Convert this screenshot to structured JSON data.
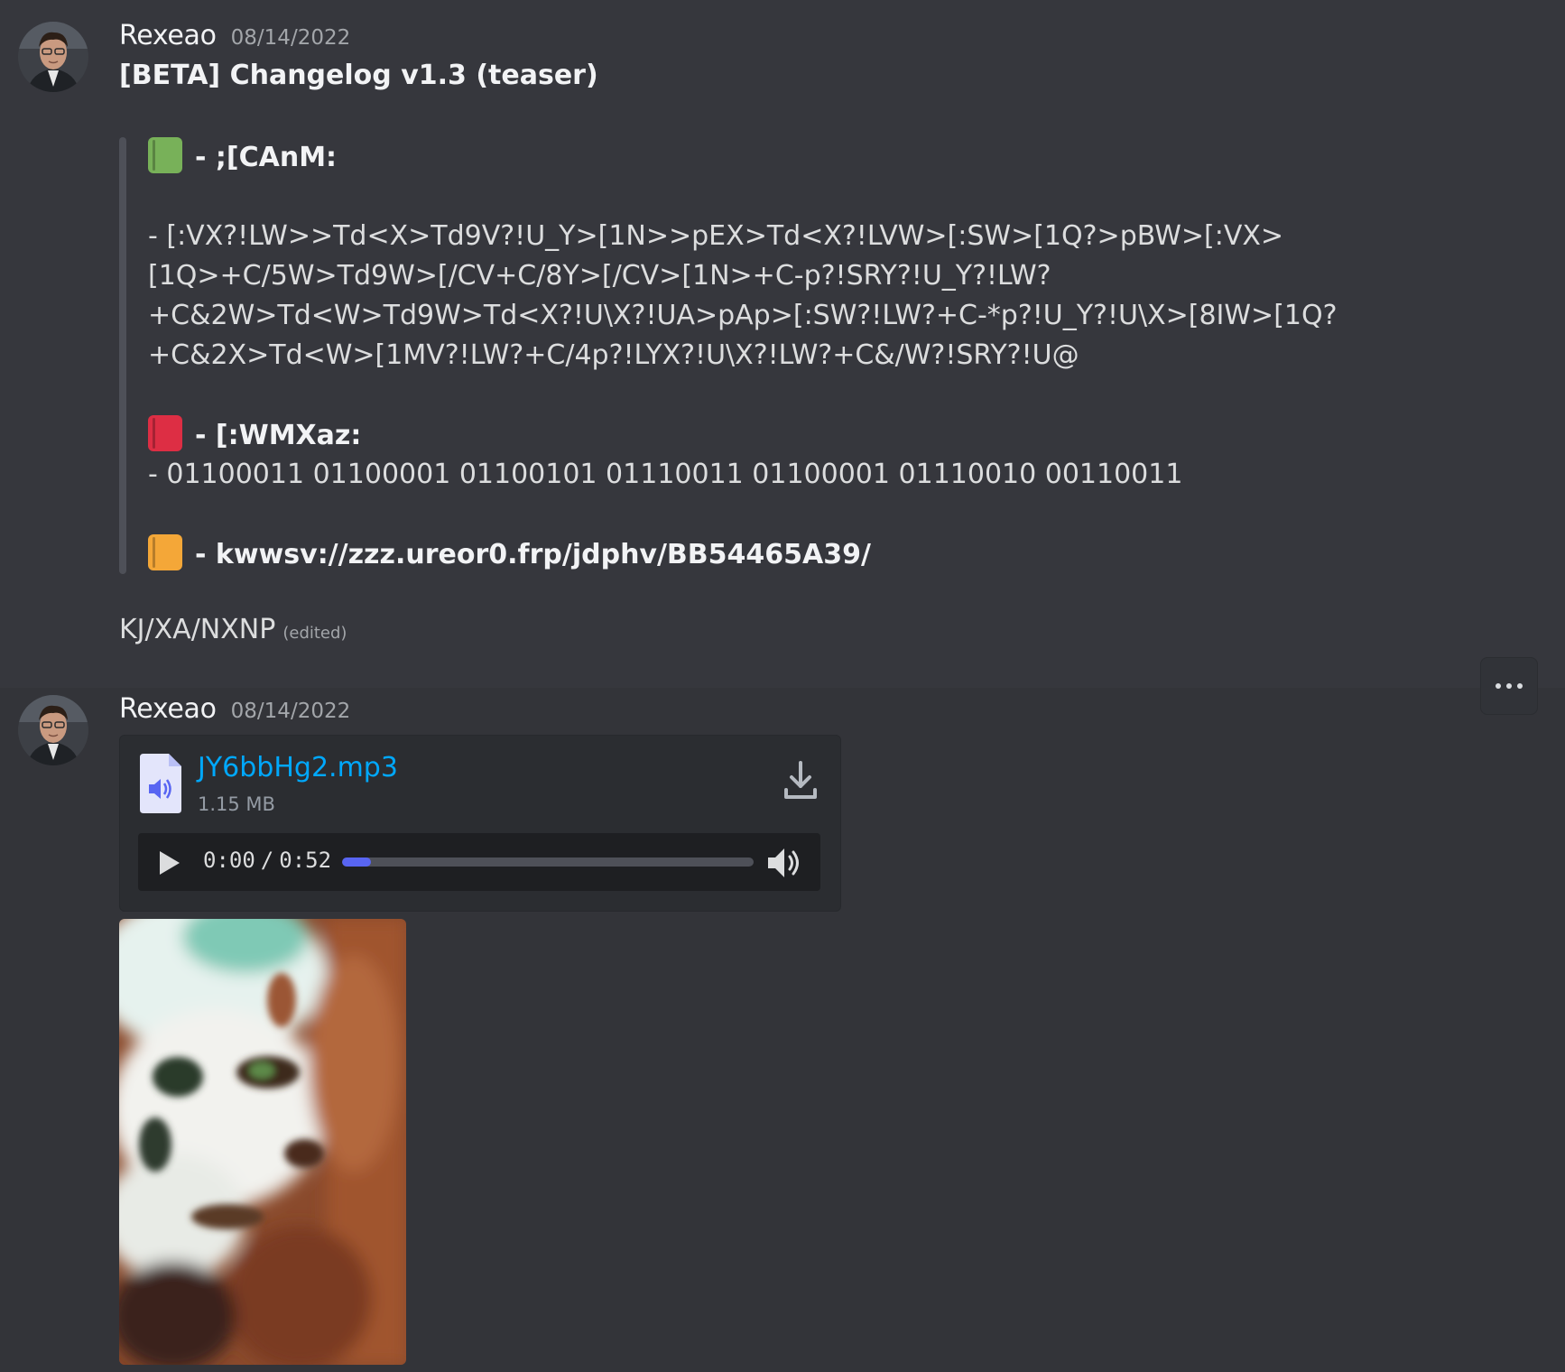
{
  "messages": [
    {
      "author": "Rexeao",
      "timestamp": "08/14/2022",
      "title": "[BETA] Changelog v1.3 (teaser)",
      "quote": {
        "section1_label": "- ;[CAnM:",
        "section1_lines": [
          "- [:VX?!LW>>Td<X>Td9V?!U_Y>[1N>>pEX>Td<X?!LVW>[:SW>[1Q?>pBW>[:VX>",
          "[1Q>+C/5W>Td9W>[/CV+C/8Y>[/CV>[1N>+C-p?!SRY?!U_Y?!LW?",
          "+C&2W>Td<W>Td9W>Td<X?!U\\X?!UA>pAp>[:SW?!LW?+C-*p?!U_Y?!U\\X>[8IW>[1Q?",
          "+C&2X>Td<W>[1MV?!LW?+C/4p?!LYX?!U\\X?!LW?+C&/W?!SRY?!U@"
        ],
        "section2_label": "- [:WMXaz:",
        "section2_line": "- 01100011 01100001 01100101 01110011 01100001 01110010 00110011",
        "section3_label": "- kwwsv://zzz.ureor0.frp/jdphv/BB54465A39/"
      },
      "footer": "KJ/XA/NXNP",
      "edited": "(edited)"
    },
    {
      "author": "Rexeao",
      "timestamp": "08/14/2022",
      "attachment": {
        "file_name": "JY6bbHg2.mp3",
        "file_size": "1.15 MB",
        "current_time": "0:00",
        "separator": "/",
        "duration": "0:52",
        "progress": 0.07
      }
    }
  ],
  "icons": {
    "book_green": "green-book-icon",
    "book_red": "red-book-icon",
    "book_orange": "orange-book-icon",
    "file": "audio-file-icon",
    "download": "download-icon",
    "play": "play-icon",
    "volume": "volume-icon",
    "more": "more-options-icon"
  },
  "colors": {
    "background": "#36373d",
    "link": "#00a8fc",
    "accent": "#5865f2",
    "book_green": "#78b159",
    "book_red": "#dd2e44",
    "book_orange": "#f4a738"
  }
}
